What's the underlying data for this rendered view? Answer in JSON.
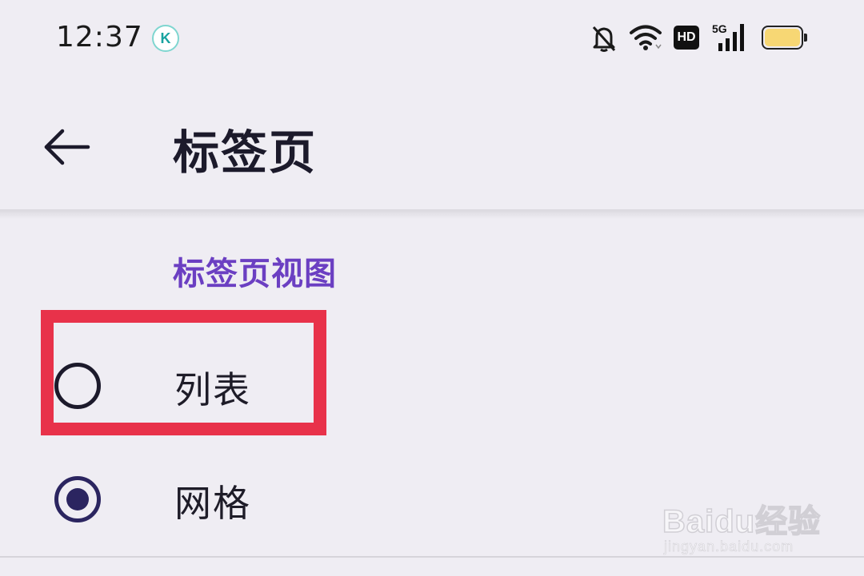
{
  "status_bar": {
    "time": "12:37",
    "app_badge": "K",
    "network": "5G",
    "hd_label": "HD",
    "icons": [
      "bell-muted-icon",
      "wifi-icon",
      "hd-icon",
      "signal-5g-icon",
      "battery-icon"
    ]
  },
  "header": {
    "title": "标签页",
    "back_icon": "arrow-left-icon"
  },
  "section": {
    "title": "标签页视图",
    "options": [
      {
        "label": "列表",
        "selected": false
      },
      {
        "label": "网格",
        "selected": true
      }
    ]
  },
  "watermark": {
    "brand": "Baidu经验",
    "url": "jingyan.baidu.com"
  },
  "colors": {
    "background": "#efedf3",
    "accent": "#6b3fc2",
    "radio_selected": "#2b2560",
    "highlight": "#e8324a",
    "battery": "#f7d774"
  }
}
